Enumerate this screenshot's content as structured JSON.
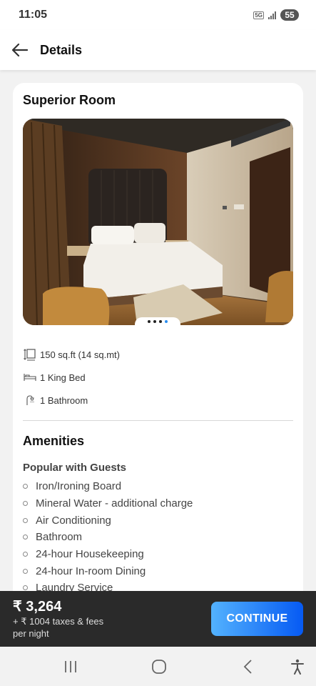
{
  "status_bar": {
    "time": "11:05",
    "network": "5G",
    "battery": "55"
  },
  "header": {
    "title": "Details"
  },
  "room": {
    "title": "Superior Room",
    "image_slides": 4,
    "active_slide": 4,
    "features": [
      {
        "icon": "area-icon",
        "text": "150 sq.ft (14 sq.mt)"
      },
      {
        "icon": "bed-icon",
        "text": "1 King Bed"
      },
      {
        "icon": "shower-icon",
        "text": "1 Bathroom"
      }
    ]
  },
  "amenities": {
    "title": "Amenities",
    "subtitle": "Popular with Guests",
    "items": [
      "Iron/Ironing Board",
      "Mineral Water - additional charge",
      "Air Conditioning",
      "Bathroom",
      "24-hour Housekeeping",
      "24-hour In-room Dining",
      "Laundry Service"
    ]
  },
  "footer": {
    "price": "₹ 3,264",
    "taxes": "+ ₹ 1004 taxes & fees",
    "per": "per night",
    "cta": "CONTINUE",
    "cta_colors": [
      "#53b2fe",
      "#065af3"
    ]
  },
  "nav": {
    "buttons": [
      "recent-apps-icon",
      "home-icon",
      "back-icon",
      "accessibility-icon"
    ]
  }
}
